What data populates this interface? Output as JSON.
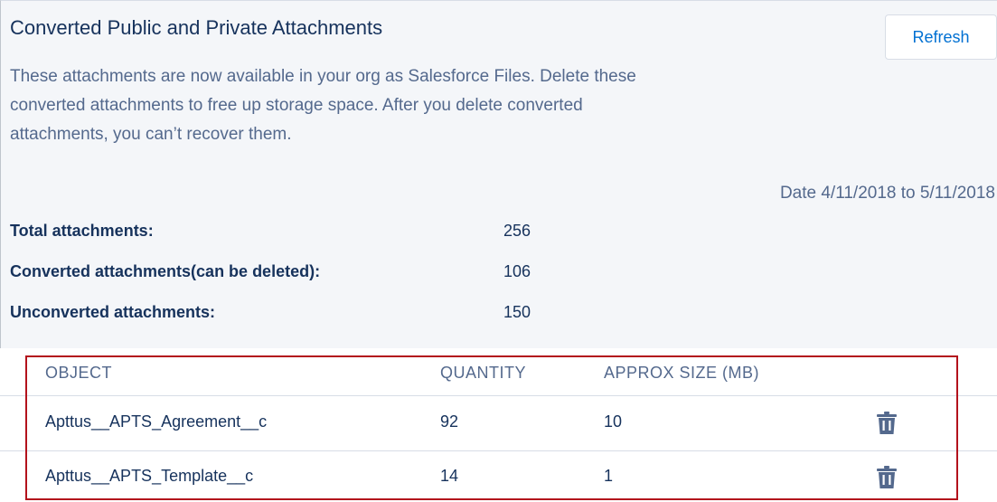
{
  "header": {
    "title": "Converted Public and Private Attachments",
    "refresh_label": "Refresh"
  },
  "description": {
    "line1": "These attachments are now available in your org as Salesforce Files. Delete these",
    "line2": "converted attachments to free up storage space. After you delete converted",
    "line3": "attachments, you can’t recover them."
  },
  "date_range": "Date 4/11/2018 to 5/11/2018",
  "stats": [
    {
      "label": "Total attachments:",
      "value": "256"
    },
    {
      "label": "Converted attachments(can be deleted):",
      "value": "106"
    },
    {
      "label": "Unconverted attachments:",
      "value": "150"
    }
  ],
  "table": {
    "columns": [
      "OBJECT",
      "QUANTITY",
      "APPROX SIZE (MB)"
    ],
    "rows": [
      {
        "object": "Apttus__APTS_Agreement__c",
        "quantity": "92",
        "size": "10",
        "action_icon": "trash-icon"
      },
      {
        "object": "Apttus__APTS_Template__c",
        "quantity": "14",
        "size": "1",
        "action_icon": "trash-icon"
      }
    ]
  },
  "colors": {
    "link": "#0070d2",
    "text": "#16325c",
    "muted": "#54698d",
    "highlight": "#b3121c",
    "panel_bg": "#f4f6f9",
    "icon": "#54698d"
  }
}
